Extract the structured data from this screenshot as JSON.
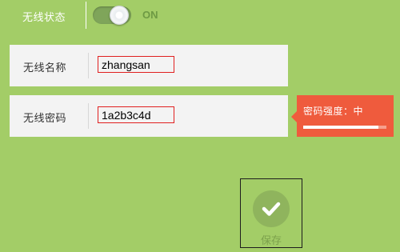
{
  "wireless_status": {
    "label": "无线状态",
    "toggle_state": "ON",
    "enabled": true
  },
  "ssid": {
    "label": "无线名称",
    "value": "zhangsan"
  },
  "password": {
    "label": "无线密码",
    "value": "1a2b3c4d",
    "strength_text": "密码强度：中",
    "strength_level": 0.9
  },
  "save": {
    "label": "保存",
    "icon": "checkmark-icon"
  },
  "colors": {
    "background": "#a3cd67",
    "accent": "#8fb45d",
    "toggle_text": "#6e9a44",
    "strength_box": "#ef5b3d",
    "input_border": "#e02020"
  }
}
